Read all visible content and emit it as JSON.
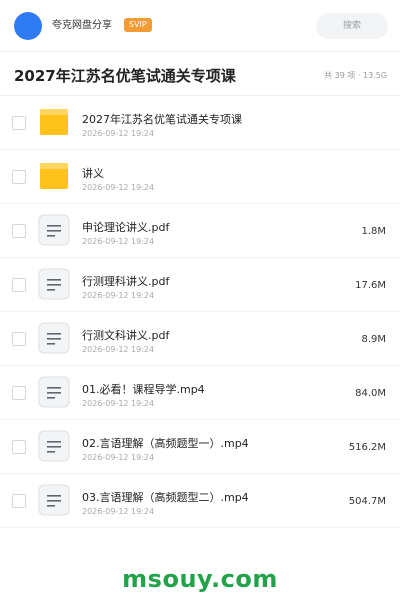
{
  "header": {
    "share_name": "夸克网盘分享",
    "badge": "SVIP",
    "search_placeholder": "搜索"
  },
  "folder": {
    "title": "2027年江苏名优笔试通关专项课",
    "meta": "共 39 项 · 13.5G"
  },
  "files": [
    {
      "type": "folder",
      "name": "2027年江苏名优笔试通关专项课",
      "date": "2026-09-12 19:24",
      "size": ""
    },
    {
      "type": "folder",
      "name": "讲义",
      "date": "2026-09-12 19:24",
      "size": ""
    },
    {
      "type": "file",
      "name": "申论理论讲义.pdf",
      "date": "2026-09-12 19:24",
      "size": "1.8M"
    },
    {
      "type": "file",
      "name": "行测理科讲义.pdf",
      "date": "2026-09-12 19:24",
      "size": "17.6M"
    },
    {
      "type": "file",
      "name": "行测文科讲义.pdf",
      "date": "2026-09-12 19:24",
      "size": "8.9M"
    },
    {
      "type": "file",
      "name": "01.必看！课程导学.mp4",
      "date": "2026-09-12 19:24",
      "size": "84.0M"
    },
    {
      "type": "file",
      "name": "02.言语理解（高频题型一）.mp4",
      "date": "2026-09-12 19:24",
      "size": "516.2M"
    },
    {
      "type": "file",
      "name": "03.言语理解（高频题型二）.mp4",
      "date": "2026-09-12 19:24",
      "size": "504.7M"
    }
  ],
  "watermark": "msouy.com",
  "colors": {
    "avatar": "#2f7bf6",
    "badge": "#f39b34",
    "folder": "#ffc21a",
    "watermark": "#22a34a"
  }
}
